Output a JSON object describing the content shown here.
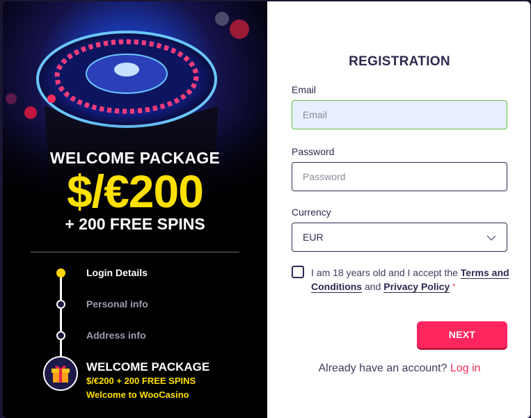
{
  "promo": {
    "top": "WELCOME PACKAGE",
    "amount": "$/€200",
    "bottom": "+ 200 FREE SPINS"
  },
  "steps": [
    {
      "label": "Login Details",
      "active": true
    },
    {
      "label": "Personal info",
      "active": false
    },
    {
      "label": "Address info",
      "active": false
    }
  ],
  "welcome": {
    "title": "WELCOME PACKAGE",
    "line1": "$/€200 + 200 FREE SPINS",
    "line2": "Welcome to WooCasino"
  },
  "form": {
    "title": "REGISTRATION",
    "email_label": "Email",
    "email_placeholder": "Email",
    "password_label": "Password",
    "password_placeholder": "Password",
    "currency_label": "Currency",
    "currency_value": "EUR",
    "terms_prefix": "I am 18 years old and I accept the",
    "terms_link": "Terms and Conditions",
    "terms_and": "and",
    "privacy_link": "Privacy Policy",
    "required_mark": "*",
    "next_label": "NEXT",
    "signin_text": "Already have an account?",
    "login_link": "Log in"
  },
  "colors": {
    "accent": "#ff2660",
    "gold": "#ffe000",
    "navy": "#2d2a4f"
  },
  "icons": [
    "roulette-image",
    "gift-icon",
    "chevron-down-icon"
  ]
}
